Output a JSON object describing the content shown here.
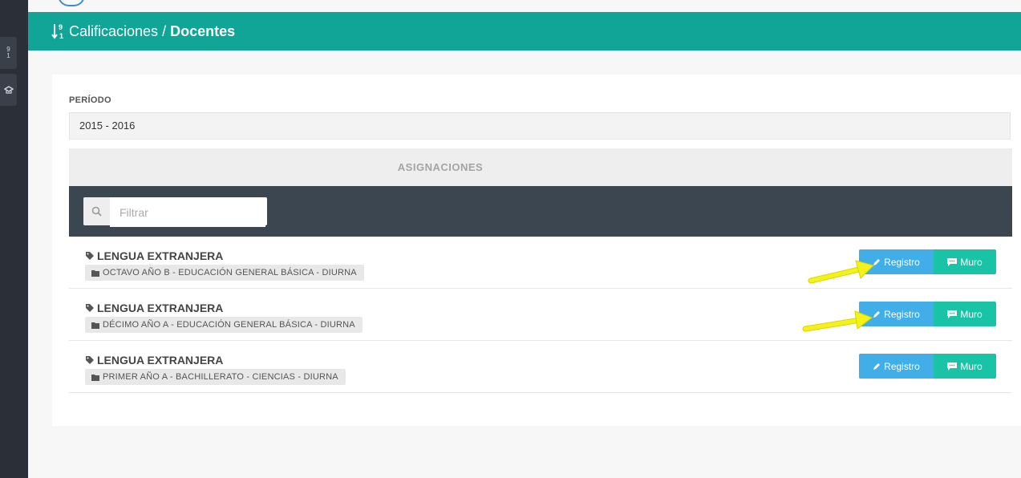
{
  "header": {
    "crumb_parent": "Calificaciones",
    "separator": "/",
    "crumb_current": "Docentes",
    "icon": "sort-numeric-icon"
  },
  "form": {
    "periodo_label": "PERÍODO",
    "periodo_value": "2015 - 2016"
  },
  "section_title": "ASIGNACIONES",
  "search": {
    "placeholder": "Filtrar",
    "value": ""
  },
  "rows": [
    {
      "subject": "LENGUA EXTRANJERA",
      "group": "OCTAVO AÑO B - EDUCACIÓN GENERAL BÁSICA - DIURNA",
      "registro_label": "Registro",
      "muro_label": "Muro"
    },
    {
      "subject": "LENGUA EXTRANJERA",
      "group": "DÉCIMO AÑO A - EDUCACIÓN GENERAL BÁSICA - DIURNA",
      "registro_label": "Registro",
      "muro_label": "Muro"
    },
    {
      "subject": "LENGUA EXTRANJERA",
      "group": "PRIMER AÑO A - BACHILLERATO - CIENCIAS - DIURNA",
      "registro_label": "Registro",
      "muro_label": "Muro"
    }
  ],
  "colors": {
    "header": "#11a597",
    "registro": "#42aee8",
    "muro": "#19c3a5",
    "annotation_arrow": "#f5f21a"
  }
}
